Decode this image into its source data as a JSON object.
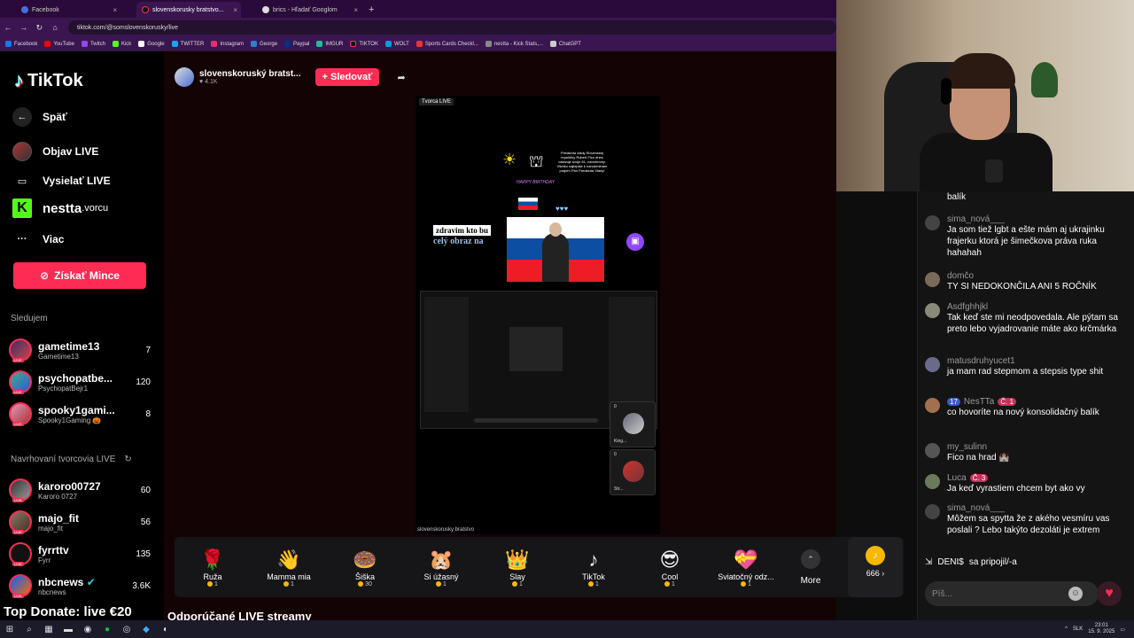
{
  "browser": {
    "tabs": [
      {
        "label": "Facebook",
        "active": false
      },
      {
        "label": "slovenskorusky bratstvo...",
        "active": true
      },
      {
        "label": "brics - Hľadať Googlom",
        "active": false
      }
    ],
    "url": "tiktok.com/@somslovenskorusky/live",
    "bookmarks": [
      "Facebook",
      "YouTube",
      "Twitch",
      "Kick",
      "Google",
      "TWITTER",
      "Instagram",
      "George",
      "Paypal",
      "IMGUR",
      "TIKTOK",
      "WOLT",
      "Sports Cards Checkl...",
      "nestta - Kick Stats,...",
      "ChatGPT"
    ]
  },
  "sidebar": {
    "logo": "TikTok",
    "back": "Späť",
    "nav": [
      {
        "label": "Objav LIVE"
      },
      {
        "label": "Vysielať LIVE"
      },
      {
        "label": "Viac"
      }
    ],
    "nestta": "nestta",
    "nestta_suffix": ".vorcu",
    "coins_button": "Získať Mince",
    "following_title": "Sledujem",
    "following": [
      {
        "name": "gametime13",
        "handle": "Gametime13",
        "count": "7"
      },
      {
        "name": "psychopatbe...",
        "handle": "PsychopatBejr1",
        "count": "120"
      },
      {
        "name": "spooky1gami...",
        "handle": "Spooky1Gaming 🎃",
        "count": "8"
      }
    ],
    "suggested_title": "Navrhovaní tvorcovia LIVE",
    "suggested": [
      {
        "name": "karoro00727",
        "handle": "Karoro 0727",
        "count": "60"
      },
      {
        "name": "majo_fit",
        "handle": "majo_fit",
        "count": "56"
      },
      {
        "name": "fyrrttv",
        "handle": "Fyrr",
        "count": "135"
      },
      {
        "name": "nbcnews",
        "handle": "nbcnews",
        "count": "3.6K"
      }
    ],
    "overlay": "Top Donate: live €20"
  },
  "stream": {
    "host_name": "slovenskoruský bratst...",
    "host_likes": "4.1K",
    "follow_button": "+ Sledovať",
    "label": "Tvorca LIVE",
    "footer": "slovenskorusky bratstvo",
    "overlay_line1": "zdravim kto bu",
    "overlay_line2": "celý obraz na",
    "ad_text": "Predseda vlády Slovenskej republiky Robert Fico dnes oslavuje svoje 61. narodeniny. Všetko najlepšie k narodeninám prajem Pán Predseda Vlády!",
    "bday": "HAPPY BIRTHDAY",
    "mini1": "King...",
    "mini2": "Str...",
    "mini_count": "0"
  },
  "gifts": [
    {
      "icon": "🌹",
      "name": "Ruža",
      "cost": "1"
    },
    {
      "icon": "👋",
      "name": "Mamma mia",
      "cost": "1"
    },
    {
      "icon": "🍩",
      "name": "Šiška",
      "cost": "30"
    },
    {
      "icon": "🐹",
      "name": "Si úžasný",
      "cost": "1"
    },
    {
      "icon": "👑",
      "name": "Slay",
      "cost": "1"
    },
    {
      "icon": "♪",
      "name": "TikTok",
      "cost": "1"
    },
    {
      "icon": "😎",
      "name": "Cool",
      "cost": "1"
    },
    {
      "icon": "💝",
      "name": "Sviatočný odz...",
      "cost": "1"
    }
  ],
  "more_label": "More",
  "coin_balance": "666 ›",
  "recommended_title": "Odporúčané LIVE streamy",
  "chat": {
    "messages": [
      {
        "user": "",
        "text": "balík",
        "color": "#555"
      },
      {
        "user": "sima_nová___",
        "text": "Ja som tiež lgbt a ešte mám aj ukrajinku frajerku ktorá je šimečkova práva ruka hahahah",
        "color": "#444"
      },
      {
        "user": "domčo",
        "text": "TY SI NEDOKONČILA ANI 5 ROČNÍK",
        "color": "#7a6a5a"
      },
      {
        "user": "Asdfghhjkl",
        "text": "Tak keď ste mi neodpovedala. Ale pýtam sa preto lebo vyjadrovanie máte ako krčmárka",
        "color": "#8a8a7a"
      },
      {
        "user": "matusdruhyucet1",
        "text": "ja mam rad stepmom a stepsis type shit",
        "color": "#6a6a8a"
      },
      {
        "user": "NesTTa",
        "text": "co hovoríte na nový konsolidačný balík",
        "color": "#a07050",
        "badge1": "17",
        "badge2": "Č. 1"
      },
      {
        "user": "my_sulinn",
        "text": "Fico na hrad 🏰",
        "color": "#555"
      },
      {
        "user": "Luca",
        "text": "Ja keď vyrastiem chcem byt ako vy",
        "color": "#6a7a5a",
        "badge2": "Č. 3"
      },
      {
        "user": "sima_nová___",
        "text": "Môžem sa spytta že z akého vesmíru vas poslali ? Lebo takýto dezoláti je extrem",
        "color": "#444"
      }
    ],
    "join_user": "DENI$",
    "join_text": "sa pripojil/-a",
    "input_placeholder": "Píš..."
  },
  "taskbar": {
    "lang": "SLK",
    "time": "23:01",
    "date": "15. 9. 2025"
  },
  "colors": {
    "accent": "#fe2c55",
    "coin": "#f6b800",
    "browser": "#3a1650"
  }
}
